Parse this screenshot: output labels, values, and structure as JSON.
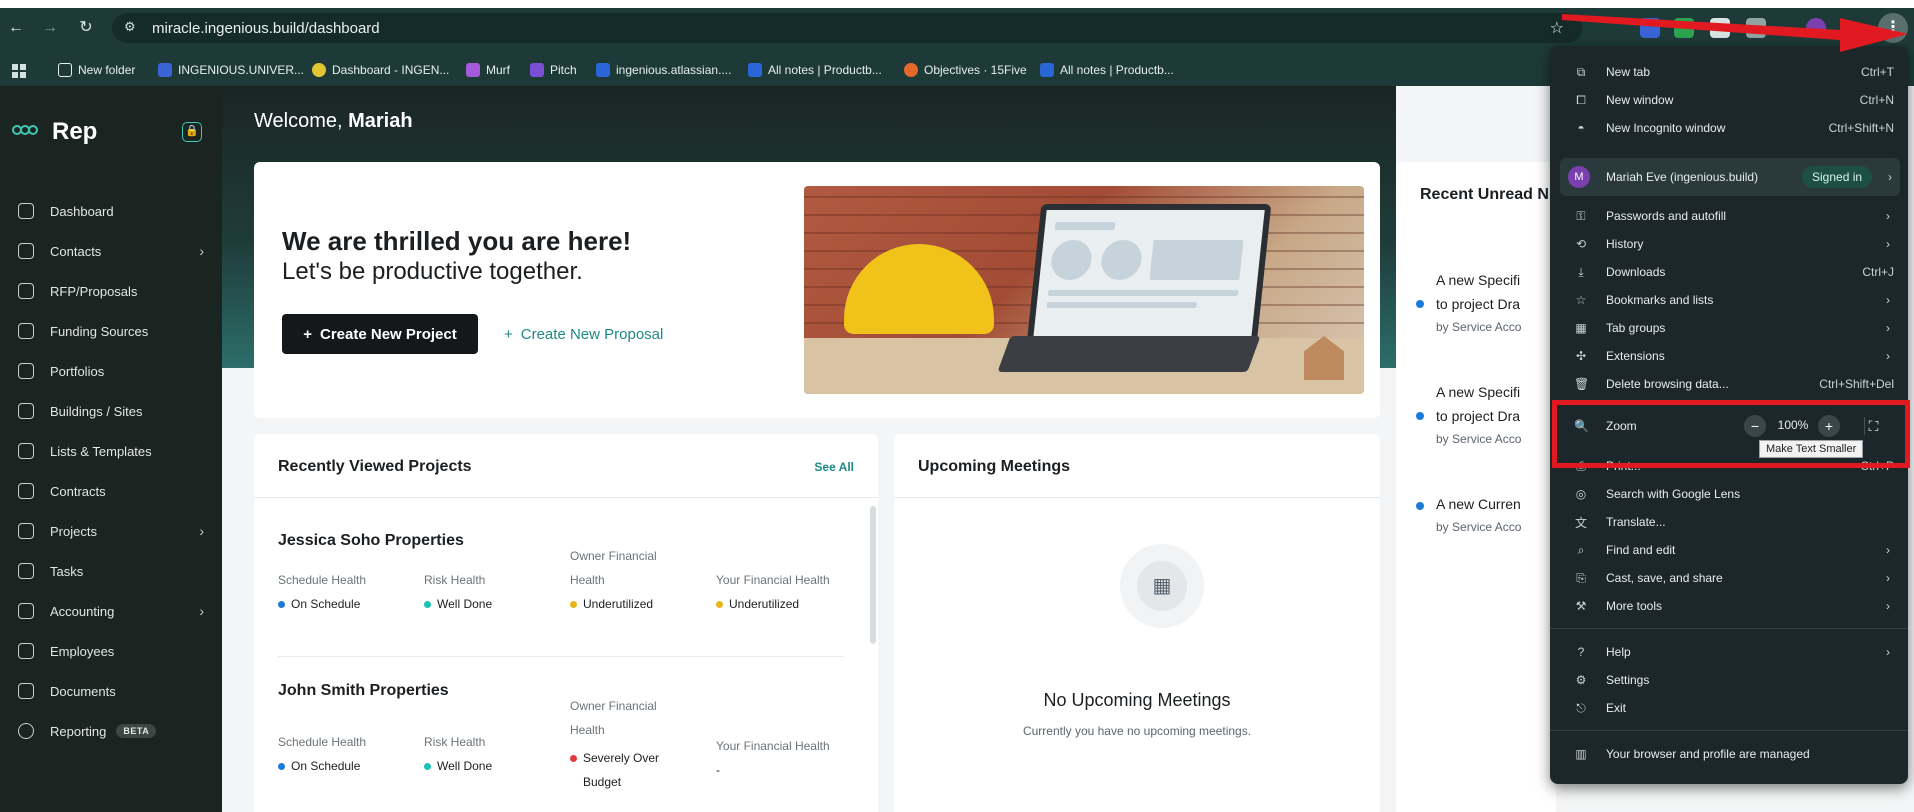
{
  "browser": {
    "url": "miracle.ingenious.build/dashboard",
    "bookmarks": [
      {
        "label": "New folder",
        "icon": "folder-icon",
        "color": "#e6efee"
      },
      {
        "label": "INGENIOUS.UNIVER...",
        "icon": "zm-logo-icon",
        "color": "#3a63d6"
      },
      {
        "label": "Dashboard - INGEN...",
        "icon": "dashboard-favicon-icon",
        "color": "#e3c433"
      },
      {
        "label": "Murf",
        "icon": "murf-icon",
        "color": "#a55ad9"
      },
      {
        "label": "Pitch",
        "icon": "pitch-icon",
        "color": "#7a4fd6"
      },
      {
        "label": "ingenious.atlassian....",
        "icon": "atlassian-icon",
        "color": "#2b66d9"
      },
      {
        "label": "All notes | Productb...",
        "icon": "productboard-icon",
        "color": "#2b66d9"
      },
      {
        "label": "Objectives · 15Five",
        "icon": "15five-icon",
        "color": "#e5692a"
      },
      {
        "label": "All notes | Productb...",
        "icon": "productboard-icon",
        "color": "#2b66d9"
      }
    ]
  },
  "app": {
    "brand": "Rep",
    "sidebar": [
      {
        "label": "Dashboard",
        "icon": "home-icon",
        "chevron": false
      },
      {
        "label": "Contacts",
        "icon": "contacts-icon",
        "chevron": true
      },
      {
        "label": "RFP/Proposals",
        "icon": "user-plus-icon",
        "chevron": false
      },
      {
        "label": "Funding Sources",
        "icon": "funding-icon",
        "chevron": false
      },
      {
        "label": "Portfolios",
        "icon": "folder-icon",
        "chevron": false
      },
      {
        "label": "Buildings / Sites",
        "icon": "cube-icon",
        "chevron": false
      },
      {
        "label": "Lists & Templates",
        "icon": "list-icon",
        "chevron": false
      },
      {
        "label": "Contracts",
        "icon": "contract-icon",
        "chevron": false
      },
      {
        "label": "Projects",
        "icon": "grid-icon",
        "chevron": true
      },
      {
        "label": "Tasks",
        "icon": "tasks-icon",
        "chevron": false
      },
      {
        "label": "Accounting",
        "icon": "table-icon",
        "chevron": true
      },
      {
        "label": "Employees",
        "icon": "employees-icon",
        "chevron": false
      },
      {
        "label": "Documents",
        "icon": "document-icon",
        "chevron": false
      },
      {
        "label": "Reporting",
        "icon": "reporting-icon",
        "chevron": false,
        "badge": "BETA"
      }
    ],
    "welcome_prefix": "Welcome,",
    "user_first_name": "Mariah",
    "hero": {
      "title": "We are thrilled you are here!",
      "subtitle": "Let's be productive together.",
      "create_project": "Create New Project",
      "create_proposal": "Create New Proposal"
    },
    "recent_projects": {
      "title": "Recently Viewed Projects",
      "see_all": "See All",
      "labels": {
        "schedule": "Schedule Health",
        "risk": "Risk Health",
        "owner_line1": "Owner Financial",
        "owner_line2": "Health",
        "your": "Your Financial Health"
      },
      "items": [
        {
          "name": "Jessica Soho Properties",
          "schedule": {
            "value": "On Schedule",
            "color": "#1c7bd9"
          },
          "risk": {
            "value": "Well Done",
            "color": "#19c3b5"
          },
          "owner": {
            "value": "Underutilized",
            "color": "#e8b417"
          },
          "your": {
            "value": "Underutilized",
            "color": "#e8b417"
          }
        },
        {
          "name": "John Smith Properties",
          "schedule": {
            "value": "On Schedule",
            "color": "#1c7bd9"
          },
          "risk": {
            "value": "Well Done",
            "color": "#19c3b5"
          },
          "owner": {
            "value_line1": "Severely Over",
            "value_line2": "Budget",
            "color": "#e03a3a"
          },
          "your": {
            "value": "-"
          }
        }
      ]
    },
    "meetings": {
      "title": "Upcoming Meetings",
      "empty_title": "No Upcoming Meetings",
      "empty_sub": "Currently you have no upcoming meetings."
    },
    "notifications": {
      "title": "Recent Unread N",
      "items": [
        {
          "line1": "A new Specifi",
          "line2": "to project Dra",
          "by_prefix": "by",
          "by": "Service Acco"
        },
        {
          "line1": "A new Specifi",
          "line2": "to project Dra",
          "by_prefix": "by",
          "by": "Service Acco"
        },
        {
          "line1": "A new Curren",
          "by_prefix": "by",
          "by": "Service Acco"
        }
      ]
    }
  },
  "chrome_menu": {
    "new_tab": {
      "label": "New tab",
      "shortcut": "Ctrl+T"
    },
    "new_window": {
      "label": "New window",
      "shortcut": "Ctrl+N"
    },
    "incognito": {
      "label": "New Incognito window",
      "shortcut": "Ctrl+Shift+N"
    },
    "profile": {
      "initial": "M",
      "name": "Mariah Eve (ingenious.build)",
      "status": "Signed in"
    },
    "passwords": "Passwords and autofill",
    "history": "History",
    "downloads": {
      "label": "Downloads",
      "shortcut": "Ctrl+J"
    },
    "bookmarks": "Bookmarks and lists",
    "tab_groups": "Tab groups",
    "extensions": "Extensions",
    "delete_data": {
      "label": "Delete browsing data...",
      "shortcut": "Ctrl+Shift+Del"
    },
    "zoom": {
      "label": "Zoom",
      "level": "100%",
      "minus": "−",
      "plus": "+",
      "tooltip": "Make Text Smaller"
    },
    "print": {
      "label": "Print...",
      "shortcut": "Ctrl+P"
    },
    "lens": "Search with Google Lens",
    "translate": "Translate...",
    "find_edit": "Find and edit",
    "cast": "Cast, save, and share",
    "more_tools": "More tools",
    "help": "Help",
    "settings": "Settings",
    "exit": "Exit",
    "managed": "Your browser and profile are managed"
  },
  "colors": {
    "accent_teal": "#1f8a84",
    "annotation_red": "#e01a20",
    "menu_bg": "#1c272b"
  }
}
